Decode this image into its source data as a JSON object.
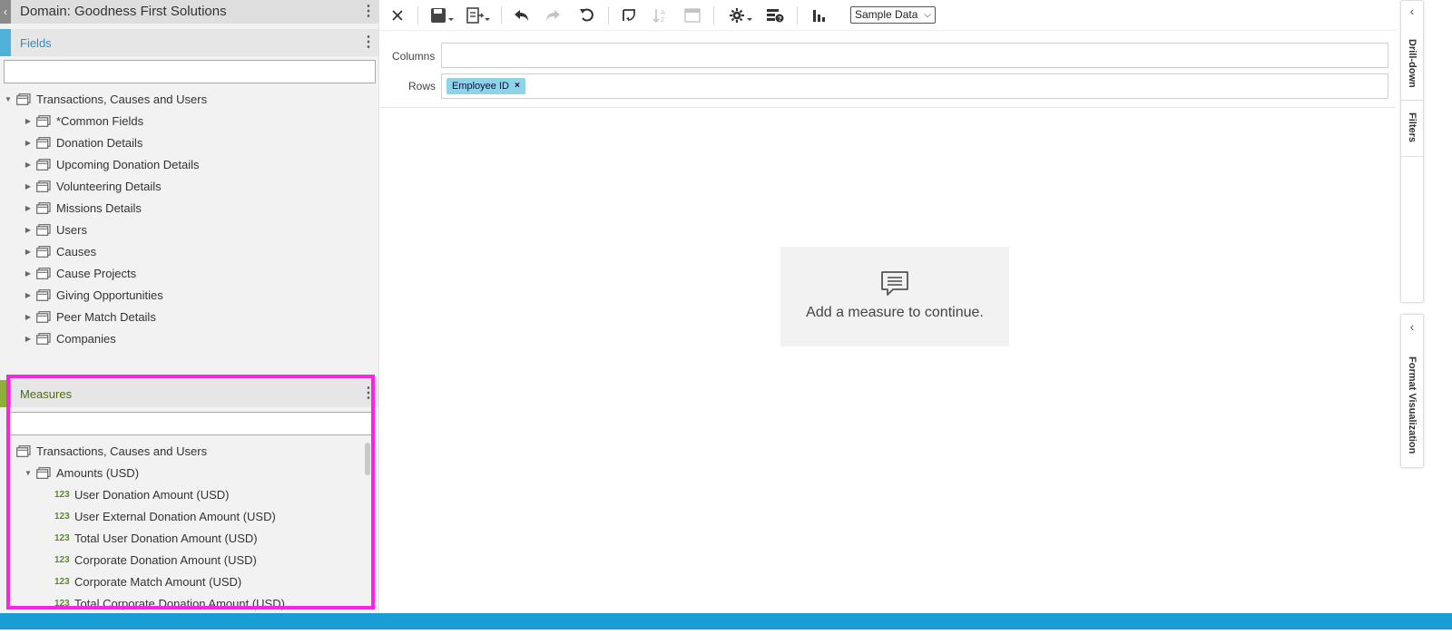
{
  "left_panel": {
    "domain_title": "Domain: Goodness First Solutions",
    "fields": {
      "title": "Fields",
      "search_value": "",
      "root": "Transactions, Causes and Users",
      "items": [
        "*Common Fields",
        "Donation Details",
        "Upcoming Donation Details",
        "Volunteering Details",
        "Missions Details",
        "Users",
        "Causes",
        "Cause Projects",
        "Giving Opportunities",
        "Peer Match Details",
        "Companies"
      ]
    },
    "measures": {
      "title": "Measures",
      "search_value": "",
      "root": "Transactions, Causes and Users",
      "group": "Amounts (USD)",
      "number_badge": "123",
      "items": [
        "User Donation Amount (USD)",
        "User External Donation Amount (USD)",
        "Total User Donation Amount (USD)",
        "Corporate Donation Amount (USD)",
        "Corporate Match Amount (USD)",
        "Total Corporate Donation Amount (USD)"
      ]
    }
  },
  "toolbar": {
    "sample_data_label": "Sample Data",
    "icons": [
      "close-icon",
      "save-icon",
      "export-icon",
      "undo-icon",
      "redo-icon",
      "undo-all-icon",
      "pivot-icon",
      "sort-icon",
      "data-view-icon",
      "settings-icon",
      "query-icon",
      "chart-type-icon"
    ]
  },
  "query": {
    "columns_label": "Columns",
    "rows_label": "Rows",
    "row_pill": "Employee ID",
    "row_pill_remove": "×"
  },
  "canvas": {
    "message": "Add a measure to continue."
  },
  "right_rail": {
    "drilldown": "Drill-down",
    "filters": "Filters",
    "format": "Format Visualization"
  },
  "colors": {
    "fields_accent": "#4fb3d9",
    "measures_accent": "#8fae3a",
    "highlight": "#ff21e6",
    "pill": "#8fd3e8",
    "bottom_bar": "#1a9dd4"
  }
}
